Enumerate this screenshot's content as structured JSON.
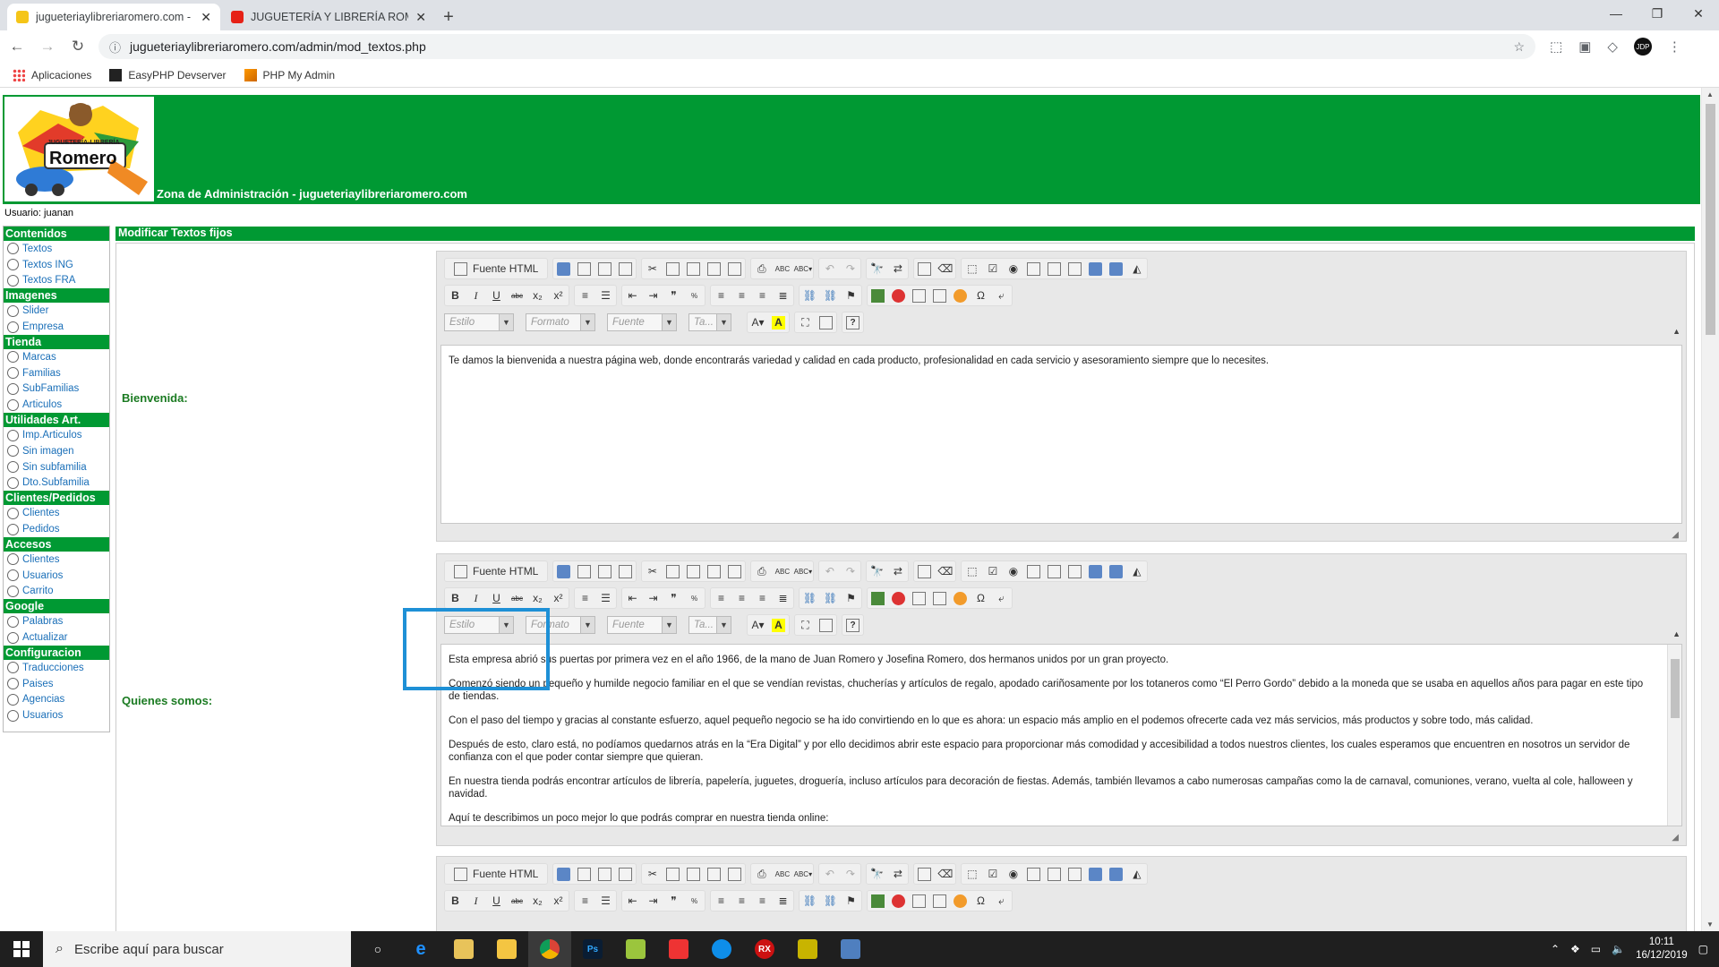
{
  "browser": {
    "tabs": [
      {
        "title": "jugueteriaylibreriaromero.com - I",
        "active": true
      },
      {
        "title": "JUGUETERÍA Y LIBRERÍA ROMERO",
        "active": false
      }
    ],
    "url": "jugueteriaylibreriaromero.com/admin/mod_textos.php",
    "bookmarks": [
      "Aplicaciones",
      "EasyPHP Devserver",
      "PHP My Admin"
    ],
    "avatar_initials": "JDP"
  },
  "header": {
    "logo_top": "JUGUETERÍA-LIBRERÍA",
    "logo_name": "Romero",
    "title": "Zona de Administración - jugueteriaylibreriaromero.com"
  },
  "user_line": "Usuario: juanan",
  "sidebar": {
    "sections": [
      {
        "title": "Contenidos",
        "items": [
          "Textos",
          "Textos ING",
          "Textos FRA"
        ]
      },
      {
        "title": "Imagenes",
        "items": [
          "Slider",
          "Empresa"
        ]
      },
      {
        "title": "Tienda",
        "items": [
          "Marcas",
          "Familias",
          "SubFamilias",
          "Articulos"
        ]
      },
      {
        "title": "Utilidades Art.",
        "items": [
          "Imp.Articulos",
          "Sin imagen",
          "Sin subfamilia",
          "Dto.Subfamilia"
        ]
      },
      {
        "title": "Clientes/Pedidos",
        "items": [
          "Clientes",
          "Pedidos"
        ]
      },
      {
        "title": "Accesos",
        "items": [
          "Clientes",
          "Usuarios",
          "Carrito"
        ]
      },
      {
        "title": "Google",
        "items": [
          "Palabras",
          "Actualizar"
        ]
      },
      {
        "title": "Configuracion",
        "items": [
          "Traducciones",
          "Paises",
          "Agencias",
          "Usuarios"
        ]
      }
    ]
  },
  "main": {
    "title": "Modificar Textos fijos",
    "editor_toolbar": {
      "source_label": "Fuente HTML",
      "style_placeholder": "Estilo",
      "format_placeholder": "Formato",
      "font_placeholder": "Fuente",
      "size_placeholder": "Ta..."
    },
    "fields": [
      {
        "label": "Bienvenida:",
        "paragraphs": [
          "Te damos la bienvenida a nuestra página web, donde encontrarás variedad y calidad en cada producto, profesionalidad en cada servicio y asesoramiento siempre que lo necesites."
        ]
      },
      {
        "label": "Quienes somos:",
        "paragraphs": [
          "Esta empresa abrió sus puertas por primera vez en el año 1966, de la mano de Juan Romero y Josefina Romero, dos hermanos unidos por un gran proyecto.",
          "Comenzó siendo un pequeño y humilde negocio familiar en el que se vendían revistas, chucherías y artículos de regalo, apodado cariñosamente por los totaneros como “El Perro Gordo” debido a la moneda que se usaba en aquellos años para pagar en este tipo de tiendas.",
          "Con el paso del tiempo y gracias al constante esfuerzo, aquel pequeño negocio se ha ido convirtiendo en lo que es ahora: un espacio más amplio en el podemos ofrecerte cada vez más servicios, más productos y sobre todo, más calidad.",
          "Después de esto, claro está, no podíamos quedarnos atrás en la “Era Digital” y por ello decidimos abrir este espacio para proporcionar más comodidad y accesibilidad a todos nuestros clientes, los cuales esperamos que encuentren en nosotros un servidor de confianza con el que poder contar siempre que quieran.",
          "En nuestra tienda podrás encontrar artículos de librería, papelería, juguetes, droguería, incluso artículos para decoración de fiestas. Además, también llevamos a cabo numerosas campañas como la de carnaval, comuniones, verano, vuelta al cole, halloween  y navidad.",
          "Aquí te describimos un poco mejor lo que podrás comprar en nuestra tienda online:"
        ]
      }
    ]
  },
  "taskbar": {
    "search_placeholder": "Escribe aquí para buscar",
    "time": "10:11",
    "date": "16/12/2019"
  }
}
